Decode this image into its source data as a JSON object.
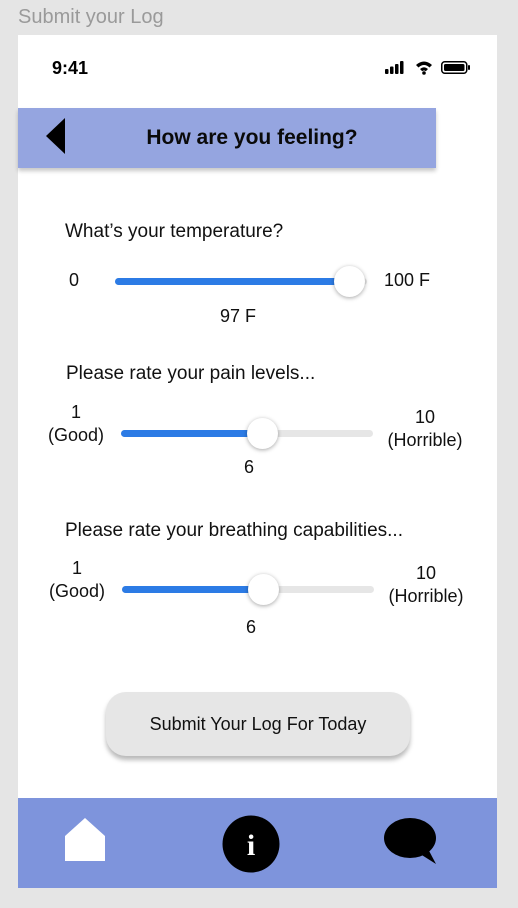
{
  "frame_label": "Submit your Log",
  "status_bar": {
    "time": "9:41"
  },
  "header": {
    "title": "How are you feeling?"
  },
  "temperature": {
    "question": "What’s your temperature?",
    "min_label": "0",
    "max_label": "100 F",
    "value_label": "97 F",
    "fraction": 0.93
  },
  "pain": {
    "question": "Please rate your pain levels...",
    "min_num": "1",
    "min_desc": "(Good)",
    "max_num": "10",
    "max_desc": "(Horrible)",
    "value_label": "6",
    "fraction": 0.56
  },
  "breathing": {
    "question": "Please rate your breathing capabilities...",
    "min_num": "1",
    "min_desc": "(Good)",
    "max_num": "10",
    "max_desc": "(Horrible)",
    "value_label": "6",
    "fraction": 0.56
  },
  "submit_label": "Submit Your Log For Today",
  "tabs": [
    {
      "icon": "home-icon"
    },
    {
      "icon": "info-icon"
    },
    {
      "icon": "chat-bubble-icon"
    }
  ],
  "colors": {
    "header_bg": "#95a5e0",
    "tabbar_bg": "#7e94dc",
    "slider_fill": "#2c7be5"
  }
}
